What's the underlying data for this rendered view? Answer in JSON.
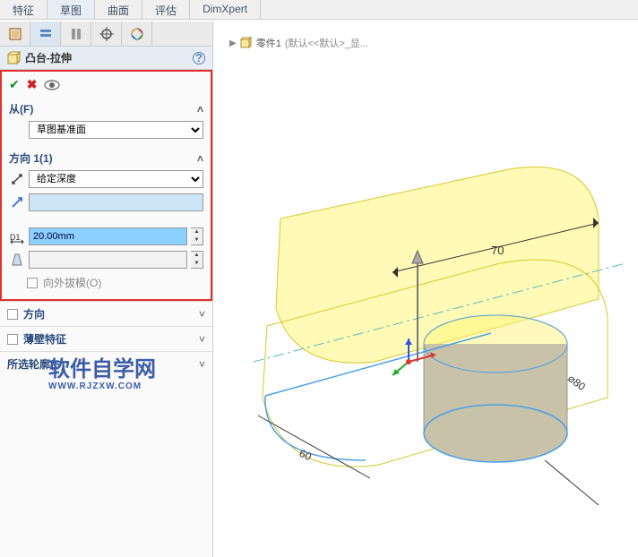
{
  "tabs": {
    "items": [
      "特征",
      "草图",
      "曲面",
      "评估",
      "DimXpert"
    ],
    "active": 1
  },
  "breadcrumb": {
    "part": "零件1",
    "suffix": "(默认<<默认>_显..."
  },
  "panel_title": "凸台-拉伸",
  "sections": {
    "from": {
      "label": "从(F)",
      "combo": "草图基准面"
    },
    "dir1": {
      "label": "方向 1(1)",
      "end_condition": "给定深度",
      "depth": "20.00mm",
      "draft_outward": "向外拔模(O)"
    },
    "dir2": {
      "label": "方向"
    },
    "thin": {
      "label": "薄壁特征"
    },
    "contour": {
      "label": "所选轮廓(S)"
    }
  },
  "chart_data": {
    "type": "other",
    "dimensions": {
      "length": 70,
      "diameter": 80
    },
    "depth_preview": 20
  },
  "watermark": {
    "main": "软件自学网",
    "sub": "WWW.RJZXW.COM"
  }
}
